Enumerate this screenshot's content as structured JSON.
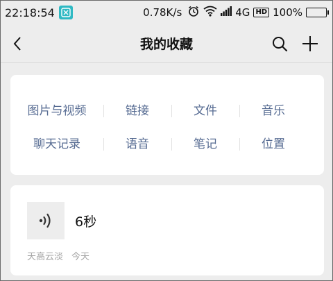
{
  "status_bar": {
    "time": "22:18:54",
    "network_speed": "0.78K/s",
    "network_type": "4G",
    "hd_label": "HD",
    "battery": "100%",
    "icons": [
      "app-notification-icon",
      "alarm-icon",
      "wifi-icon",
      "signal-icon",
      "hd-icon",
      "battery-icon"
    ]
  },
  "header": {
    "title": "我的收藏",
    "icons": [
      "back-icon",
      "search-icon",
      "add-icon"
    ]
  },
  "categories": {
    "row1": [
      "图片与视频",
      "链接",
      "文件",
      "音乐"
    ],
    "row2": [
      "聊天记录",
      "语音",
      "笔记",
      "位置"
    ],
    "text_color": "#566b92"
  },
  "favorites": [
    {
      "type_icon": "voice-icon",
      "duration": "6秒",
      "source": "天高云淡",
      "date": "今天"
    }
  ],
  "colors": {
    "background": "#ededed",
    "card": "#ffffff",
    "link": "#566b92",
    "meta": "#a3a3a3",
    "app_badge": "#2fb9c3"
  }
}
